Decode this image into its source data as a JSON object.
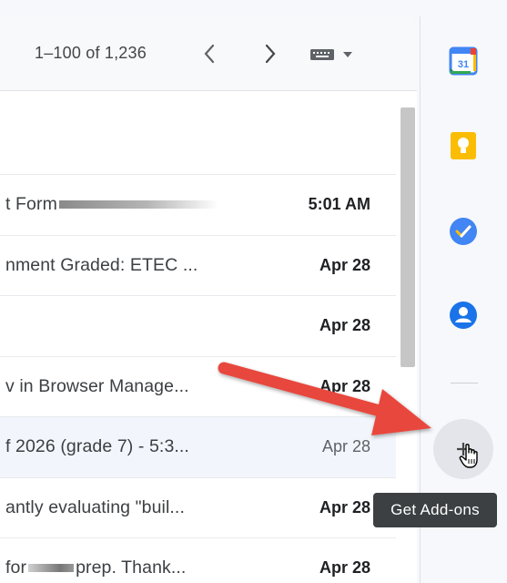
{
  "toolbar": {
    "pagination": "1–100 of 1,236",
    "prev_icon": "chevron-left-icon",
    "next_icon": "chevron-right-icon",
    "keyboard_icon": "keyboard-icon"
  },
  "emails": [
    {
      "subject": "t Form",
      "date": "5:01 AM",
      "unread": true,
      "redaction": "after"
    },
    {
      "subject": "nment Graded: ETEC ...",
      "date": "Apr 28",
      "unread": true
    },
    {
      "subject": "",
      "date": "Apr 28",
      "unread": true
    },
    {
      "subject": "v in Browser Manage...",
      "date": "Apr 28",
      "unread": true
    },
    {
      "subject": "f 2026 (grade 7) - 5:3...",
      "date": "Apr 28",
      "unread": false
    },
    {
      "subject": "antly evaluating \"buil...",
      "date": "Apr 28",
      "unread": true
    },
    {
      "subject_pre": " for",
      "subject_post": "prep. Thank...",
      "date": "Apr 28",
      "unread": true
    }
  ],
  "side_panel": {
    "apps": [
      "calendar-icon",
      "keep-icon",
      "tasks-icon",
      "contacts-icon"
    ],
    "calendar_day": "31",
    "addons_icon": "plus-icon",
    "tooltip": "Get Add-ons"
  },
  "colors": {
    "calendar_blue": "#4285f4",
    "keep_yellow": "#fbbc04",
    "tasks_blue": "#4285f4",
    "contacts_blue": "#1a73e8",
    "annotation_arrow": "#e8473c",
    "tooltip_bg": "#3c4043"
  }
}
